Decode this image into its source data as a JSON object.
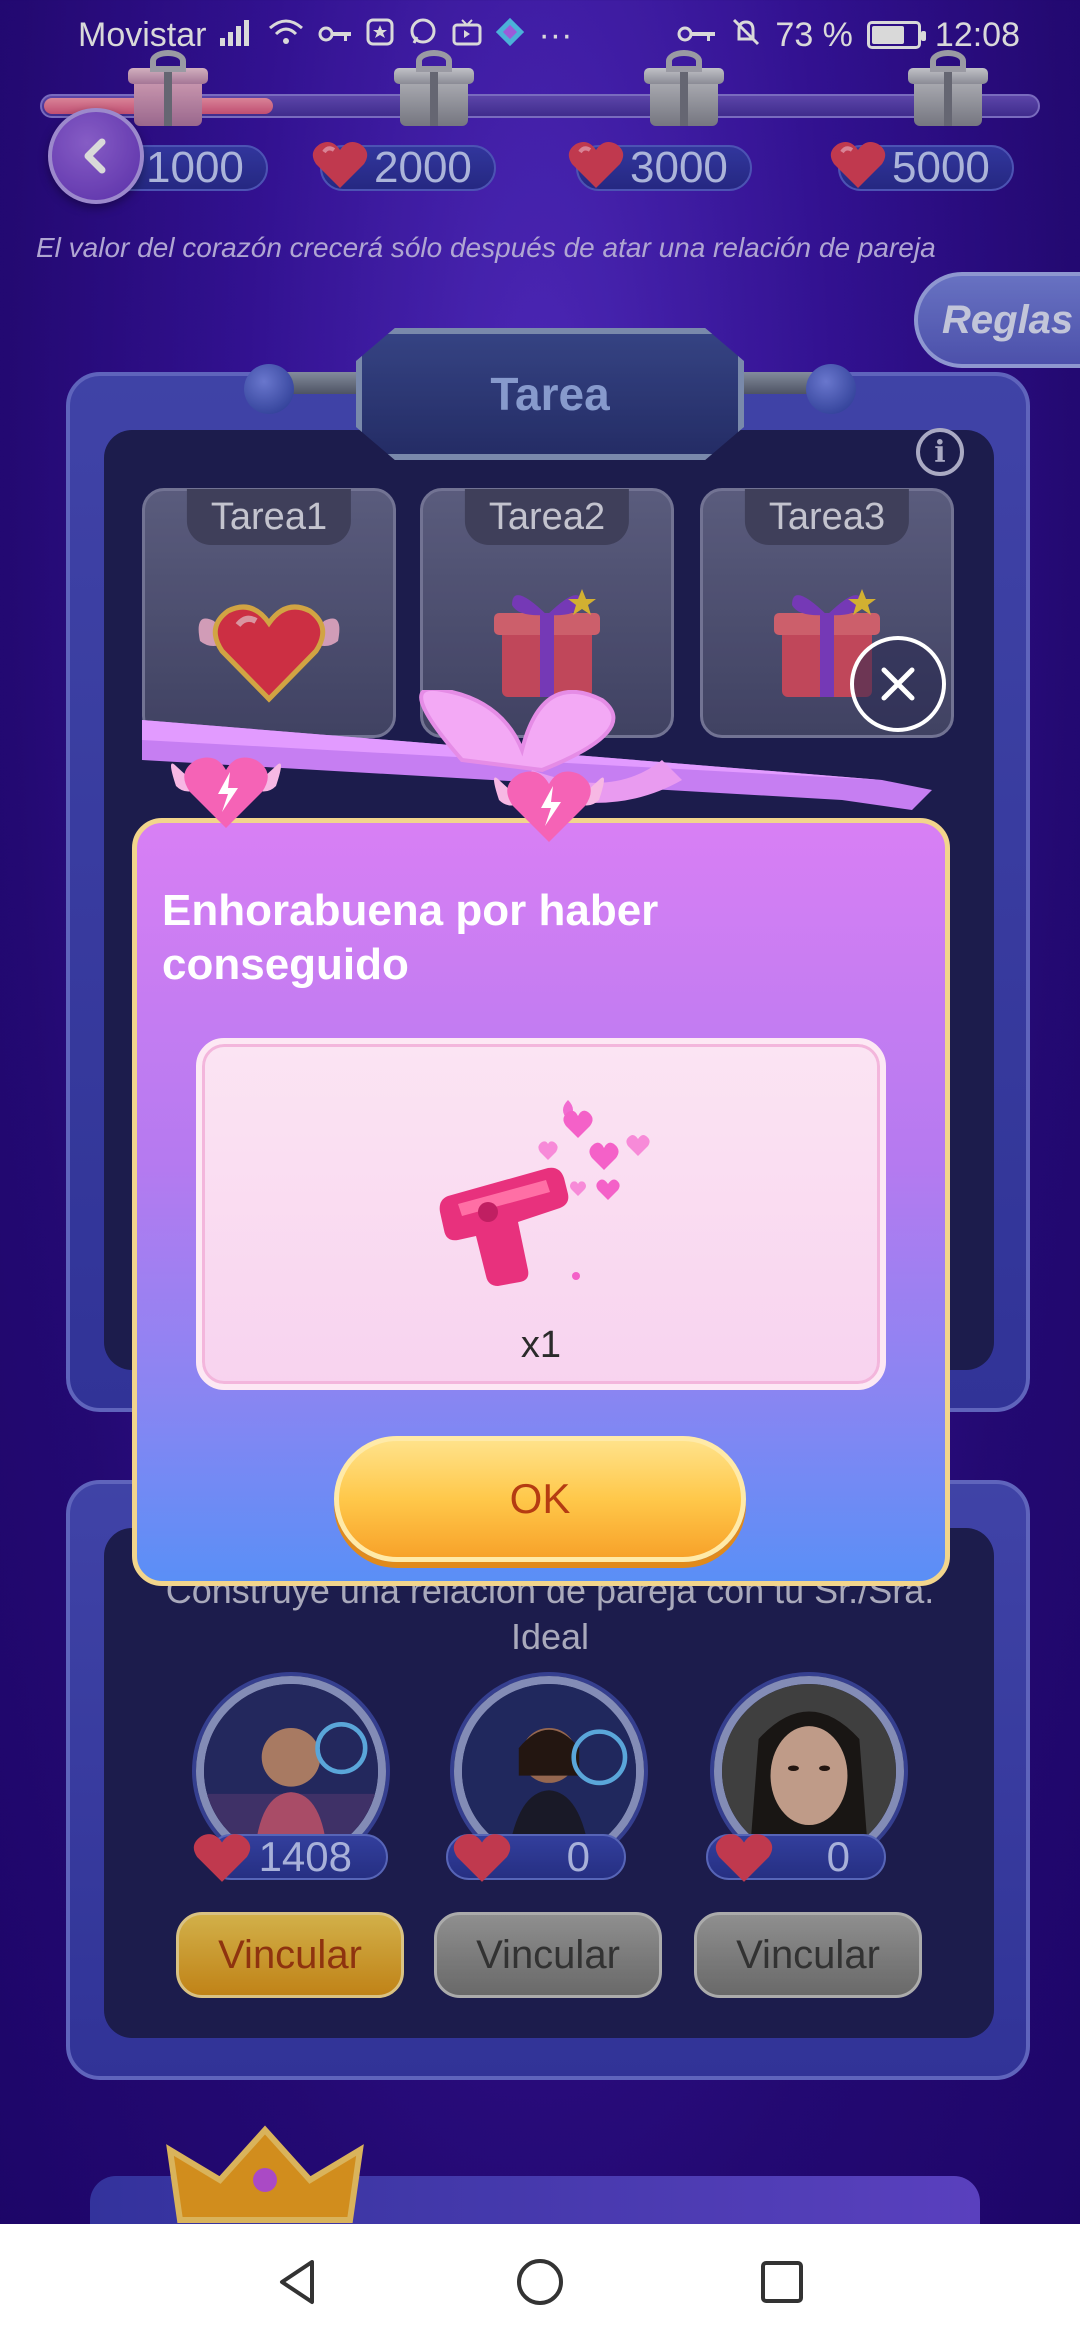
{
  "status_bar": {
    "carrier": "Movistar",
    "battery_percent": "73 %",
    "battery_level": 0.73,
    "time": "12:08",
    "icons": [
      "signal-icon",
      "wifi-icon",
      "key-icon",
      "app-icon",
      "whatsapp-icon",
      "tv-icon",
      "diamond-icon",
      "more-icon",
      "vpn-key-icon",
      "mute-icon"
    ]
  },
  "progress": {
    "fraction": 0.23,
    "milestones": [
      "1000",
      "2000",
      "3000",
      "5000"
    ]
  },
  "notice": "El valor del corazón crecerá sólo después de atar una relación de pareja",
  "rules_button": "Reglas",
  "task_panel": {
    "title": "Tarea",
    "tasks": [
      "Tarea1",
      "Tarea2",
      "Tarea3"
    ]
  },
  "couple_section": {
    "text": "Construye una relación de pareja con tu Sr./Sra. Ideal",
    "slots": [
      {
        "score": "1408",
        "button": "Vincular",
        "active": true
      },
      {
        "score": "0",
        "button": "Vincular",
        "active": false
      },
      {
        "score": "0",
        "button": "Vincular",
        "active": false
      }
    ]
  },
  "modal": {
    "title": "Enhorabuena por haber conseguido",
    "prize_icon": "heart-gun-icon",
    "prize_count": "x1",
    "ok_button": "OK"
  },
  "nav": {
    "icons": [
      "back-triangle-icon",
      "home-circle-icon",
      "recents-square-icon"
    ]
  },
  "colors": {
    "background": "#3a14a8",
    "accent_gold": "#ffc84a",
    "ok_text": "#b53c12",
    "modal_top": "#d87ff4",
    "modal_bottom": "#5a8ff6"
  }
}
